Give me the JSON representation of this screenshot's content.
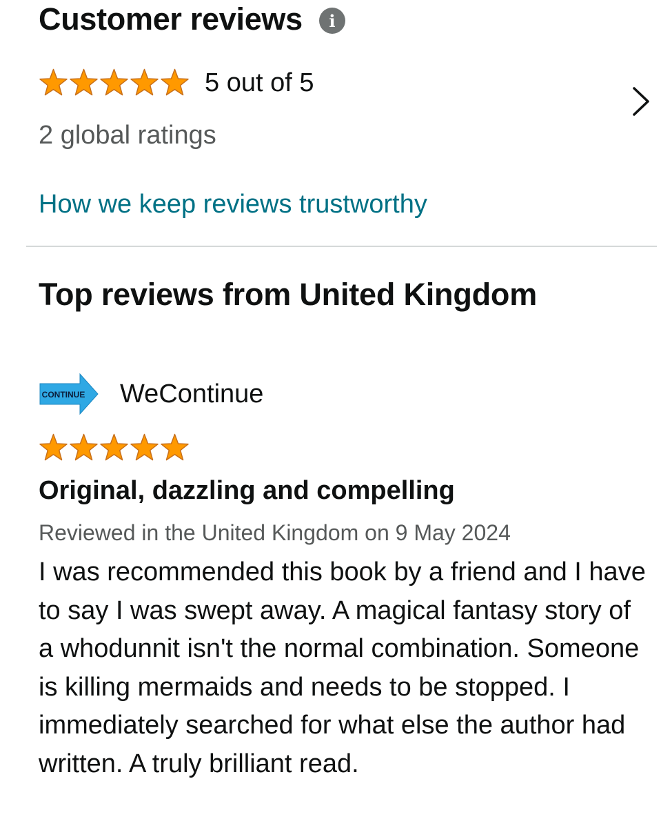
{
  "summary": {
    "title": "Customer reviews",
    "info_icon": "info-icon",
    "rating_text": "5 out of 5",
    "stars_filled": 5,
    "stars_total": 5,
    "global_ratings": "2 global ratings",
    "trust_link": "How we keep reviews trustworthy",
    "chevron_icon": "chevron-right-icon"
  },
  "top_reviews": {
    "title": "Top reviews from United Kingdom"
  },
  "review": {
    "avatar_text": "CONTINUE",
    "reviewer_name": "WeContinue",
    "stars_filled": 5,
    "stars_total": 5,
    "title": "Original, dazzling and compelling",
    "meta": "Reviewed in the United Kingdom on 9 May 2024",
    "body": "I was recommended this book by a friend and I have to say I was swept away. A magical fantasy story of a whodunnit isn't the normal combination. Someone is killing mermaids and needs to be stopped. I immediately searched for what else the author had written. A truly brilliant read."
  },
  "colors": {
    "star_fill": "#ff9900",
    "star_stroke": "#c8701b",
    "link": "#007185",
    "secondary_text": "#565959",
    "divider": "#d5d9d9",
    "avatar_arrow": "#2fa8e4"
  }
}
